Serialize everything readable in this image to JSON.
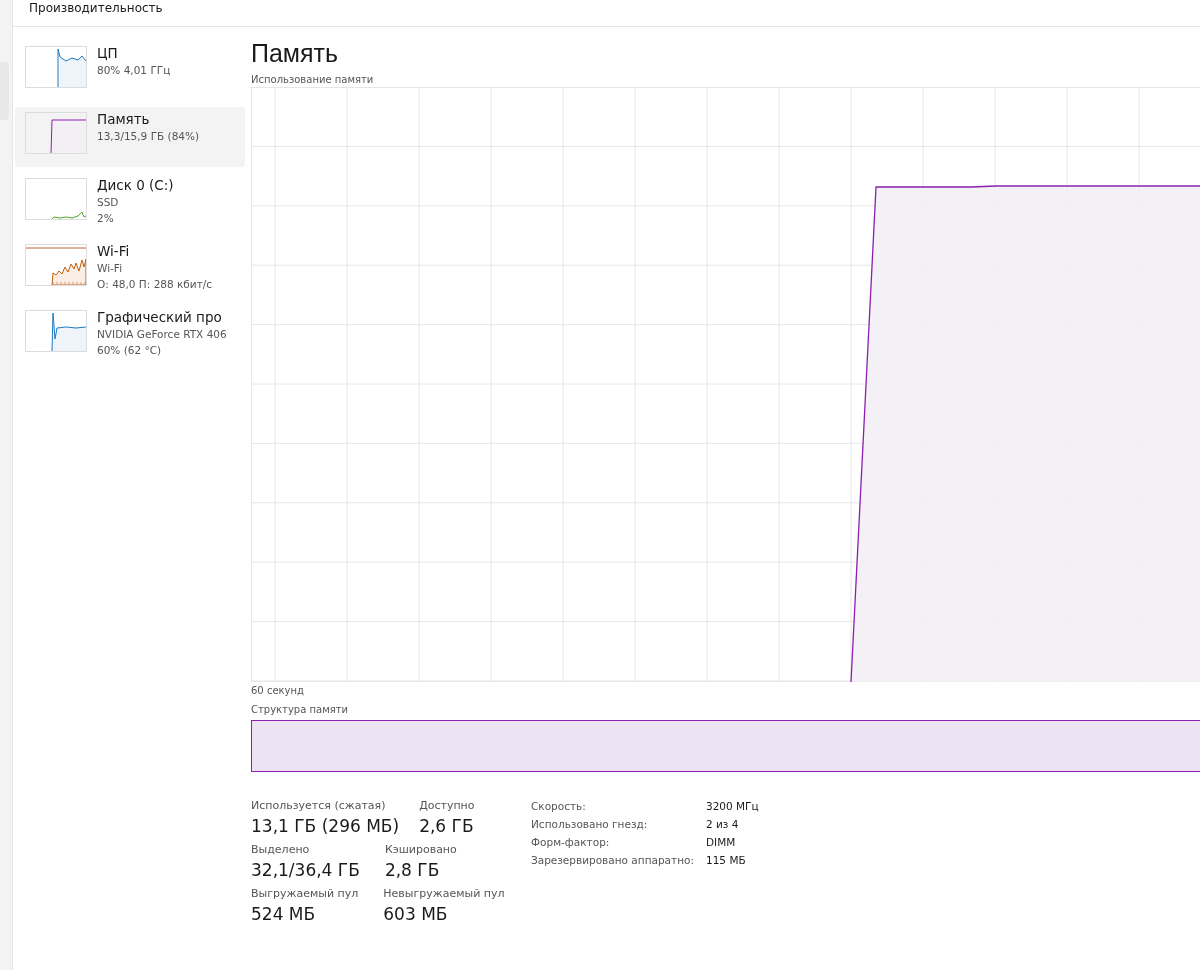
{
  "header": {
    "title": "Производительность"
  },
  "sidebar": {
    "items": [
      {
        "kind": "cpu",
        "name": "ЦП",
        "lines": [
          "80% 4,01 ГГц"
        ],
        "selected": false
      },
      {
        "kind": "memory",
        "name": "Память",
        "lines": [
          "13,3/15,9 ГБ (84%)"
        ],
        "selected": true
      },
      {
        "kind": "disk",
        "name": "Диск 0 (C:)",
        "lines": [
          "SSD",
          "2%"
        ],
        "selected": false
      },
      {
        "kind": "network",
        "name": "Wi-Fi",
        "lines": [
          "Wi-Fi",
          "О: 48,0 П: 288 кбит/с"
        ],
        "selected": false
      },
      {
        "kind": "gpu",
        "name": "Графический про",
        "lines": [
          "NVIDIA GeForce RTX 406",
          "60% (62 °C)"
        ],
        "selected": false
      }
    ]
  },
  "main": {
    "title": "Память",
    "usage_label": "Использование памяти",
    "time_label": "60 секунд",
    "composition_label": "Структура памяти",
    "stats": [
      {
        "label": "Используется (сжатая)",
        "value": "13,1 ГБ (296 МБ)"
      },
      {
        "label": "Доступно",
        "value": "2,6 ГБ"
      },
      {
        "label": "Выделено",
        "value": "32,1/36,4 ГБ"
      },
      {
        "label": "Кэшировано",
        "value": "2,8 ГБ"
      },
      {
        "label": "Выгружаемый пул",
        "value": "524 МБ"
      },
      {
        "label": "Невыгружаемый пул",
        "value": "603 МБ"
      }
    ],
    "details": [
      {
        "label": "Скорость:",
        "value": "3200 МГц"
      },
      {
        "label": "Использовано гнезд:",
        "value": "2 из 4"
      },
      {
        "label": "Форм-фактор:",
        "value": "DIMM"
      },
      {
        "label": "Зарезервировано аппаратно:",
        "value": "115 МБ"
      }
    ]
  }
}
